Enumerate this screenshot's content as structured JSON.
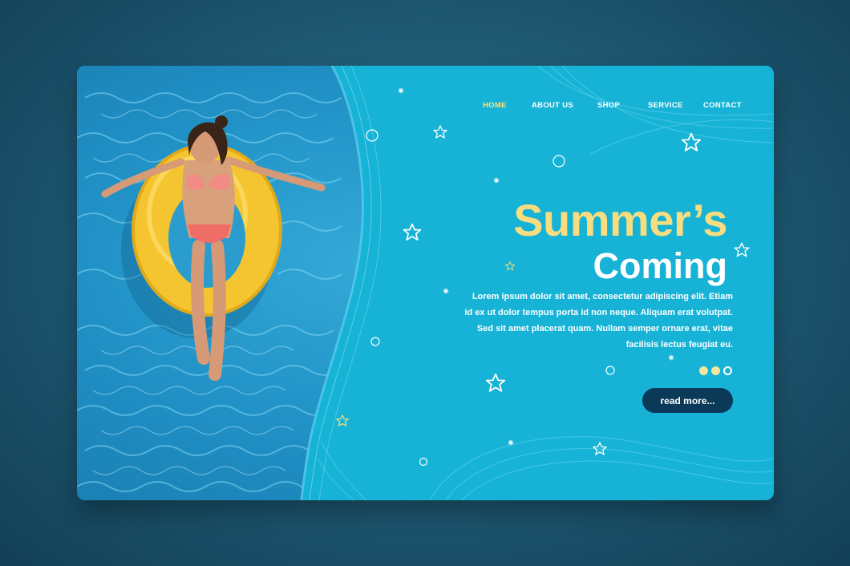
{
  "nav": {
    "items": [
      {
        "label": "HOME",
        "active": true
      },
      {
        "label": "ABOUT US",
        "active": false
      },
      {
        "label": "SHOP",
        "active": false
      },
      {
        "label": "SERVICE",
        "active": false
      },
      {
        "label": "CONTACT",
        "active": false
      }
    ]
  },
  "hero": {
    "title_line1": "Summer’s",
    "title_line2": "Coming",
    "body": "Lorem ipsum dolor sit amet, consectetur adipiscing elit. Etiam id ex ut dolor tempus porta id non neque. Aliquam erat volutpat. Sed sit amet placerat quam. Nullam semper ornare erat, vitae facilisis lectus feugiat eu.",
    "cta_label": "read more...",
    "slider": {
      "count": 3,
      "active_index": 2
    }
  },
  "colors": {
    "page_background": "#1d5670",
    "card_background": "#16b3d6",
    "title_yellow": "#f8dd80",
    "nav_active": "#ffe27a",
    "button_background": "#0b3a58",
    "float_yellow": "#f4c531"
  },
  "icons": [
    "star-icon",
    "ring-icon",
    "sparkle-icon"
  ]
}
